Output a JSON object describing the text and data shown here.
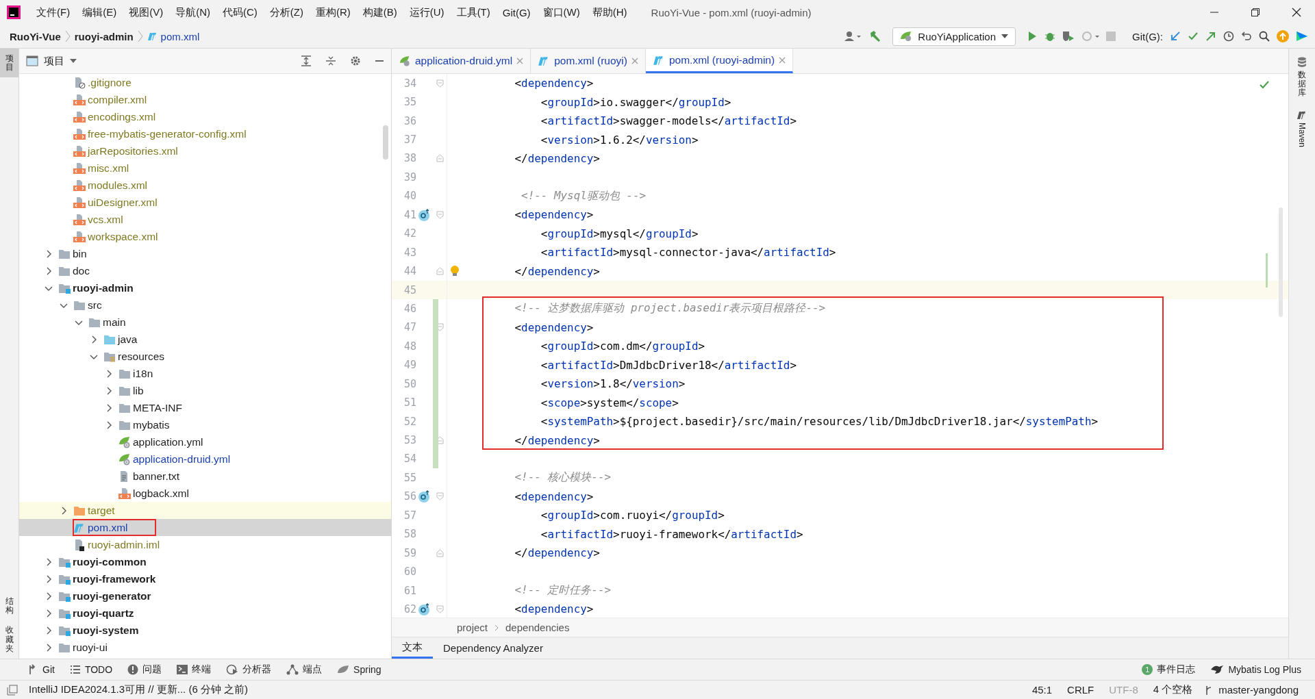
{
  "title_bar": {
    "menus": [
      "文件(F)",
      "编辑(E)",
      "视图(V)",
      "导航(N)",
      "代码(C)",
      "分析(Z)",
      "重构(R)",
      "构建(B)",
      "运行(U)",
      "工具(T)",
      "Git(G)",
      "窗口(W)",
      "帮助(H)"
    ],
    "title": "RuoYi-Vue - pom.xml (ruoyi-admin)"
  },
  "nav_bar": {
    "breadcrumbs": [
      {
        "label": "RuoYi-Vue",
        "kind": "project"
      },
      {
        "label": "ruoyi-admin",
        "kind": "module"
      },
      {
        "label": "pom.xml",
        "kind": "maven"
      }
    ],
    "run_config": "RuoYiApplication",
    "git_label": "Git(G):",
    "stop": {
      "disabled": true
    }
  },
  "left_strip": [
    {
      "label": "项目",
      "selected": true
    },
    {
      "label": "结构",
      "selected": false
    },
    {
      "label": "收藏夹",
      "selected": false
    }
  ],
  "project_panel": {
    "title": "项目"
  },
  "tree": {
    "items": [
      {
        "children": [
          {
            "label": ".gitignore",
            "kind": "ignore-file",
            "ignored": true,
            "selected": false
          },
          {
            "label": "compiler.xml",
            "kind": "xml-file",
            "ignored": true,
            "selected": false
          },
          {
            "label": "encodings.xml",
            "kind": "xml-file",
            "ignored": true,
            "selected": false
          },
          {
            "label": "free-mybatis-generator-config.xml",
            "kind": "xml-file",
            "ignored": true,
            "selected": false
          },
          {
            "label": "jarRepositories.xml",
            "kind": "xml-file",
            "ignored": true,
            "selected": false
          },
          {
            "label": "misc.xml",
            "kind": "xml-file",
            "ignored": true,
            "selected": false
          },
          {
            "label": "modules.xml",
            "kind": "xml-file",
            "ignored": true,
            "selected": false
          },
          {
            "label": "uiDesigner.xml",
            "kind": "xml-file",
            "ignored": true,
            "selected": false
          },
          {
            "label": "vcs.xml",
            "kind": "xml-file",
            "ignored": true,
            "selected": false
          },
          {
            "label": "workspace.xml",
            "kind": "xml-file",
            "ignored": true,
            "selected": false
          }
        ]
      },
      {
        "label": "bin",
        "kind": "folder",
        "expanded": false,
        "selected": false
      },
      {
        "label": "doc",
        "kind": "folder",
        "expanded": false,
        "selected": false
      },
      {
        "label": "ruoyi-admin",
        "kind": "module",
        "expanded": true,
        "selected": false,
        "children": [
          {
            "label": "src",
            "kind": "folder",
            "expanded": true,
            "selected": false,
            "children": [
              {
                "label": "main",
                "kind": "folder",
                "expanded": true,
                "selected": false,
                "children": [
                  {
                    "label": "java",
                    "kind": "source-folder",
                    "expanded": false,
                    "selected": false
                  },
                  {
                    "label": "resources",
                    "kind": "resources-folder",
                    "expanded": true,
                    "selected": false,
                    "children": [
                      {
                        "label": "i18n",
                        "kind": "folder",
                        "expanded": false,
                        "selected": false
                      },
                      {
                        "label": "lib",
                        "kind": "folder",
                        "expanded": false,
                        "selected": false
                      },
                      {
                        "label": "META-INF",
                        "kind": "folder",
                        "expanded": false,
                        "selected": false
                      },
                      {
                        "label": "mybatis",
                        "kind": "folder",
                        "expanded": false,
                        "selected": false
                      },
                      {
                        "label": "application.yml",
                        "kind": "yml-file",
                        "selected": false
                      },
                      {
                        "label": "application-druid.yml",
                        "kind": "yml-file",
                        "modified": true,
                        "selected": false
                      },
                      {
                        "label": "banner.txt",
                        "kind": "text-file",
                        "selected": false
                      },
                      {
                        "label": "logback.xml",
                        "kind": "xml-file",
                        "selected": false
                      }
                    ]
                  }
                ]
              }
            ]
          },
          {
            "label": "target",
            "kind": "excluded-folder",
            "ignored": true,
            "expanded": false,
            "selected": false
          },
          {
            "label": "pom.xml",
            "kind": "maven-file",
            "modified": true,
            "selected": true,
            "annotated": true
          },
          {
            "label": "ruoyi-admin.iml",
            "kind": "iml-file",
            "ignored": true,
            "selected": false
          }
        ]
      },
      {
        "label": "ruoyi-common",
        "kind": "module",
        "expanded": false,
        "selected": false
      },
      {
        "label": "ruoyi-framework",
        "kind": "module",
        "expanded": false,
        "selected": false
      },
      {
        "label": "ruoyi-generator",
        "kind": "module",
        "expanded": false,
        "selected": false
      },
      {
        "label": "ruoyi-quartz",
        "kind": "module",
        "expanded": false,
        "selected": false
      },
      {
        "label": "ruoyi-system",
        "kind": "module",
        "expanded": false,
        "selected": false
      },
      {
        "label": "ruoyi-ui",
        "kind": "folder",
        "expanded": false,
        "selected": false
      }
    ]
  },
  "editor_tabs": [
    {
      "label": "application-druid.yml",
      "kind": "yml",
      "selected": false
    },
    {
      "label": "pom.xml (ruoyi)",
      "kind": "maven",
      "selected": false
    },
    {
      "label": "pom.xml (ruoyi-admin)",
      "kind": "maven",
      "selected": true
    }
  ],
  "code": {
    "lines": [
      {
        "number": "34",
        "fold_start": true,
        "parts": [
          {
            "kind": "punct",
            "text": "        <"
          },
          {
            "kind": "tag",
            "text": "dependency"
          },
          {
            "kind": "punct",
            "text": ">"
          }
        ]
      },
      {
        "number": "35",
        "parts": [
          {
            "kind": "punct",
            "text": "            <"
          },
          {
            "kind": "tag",
            "text": "groupId"
          },
          {
            "kind": "punct",
            "text": ">"
          },
          {
            "kind": "text",
            "text": "io.swagger"
          },
          {
            "kind": "punct",
            "text": "</"
          },
          {
            "kind": "tag",
            "text": "groupId"
          },
          {
            "kind": "punct",
            "text": ">"
          }
        ]
      },
      {
        "number": "36",
        "parts": [
          {
            "kind": "punct",
            "text": "            <"
          },
          {
            "kind": "tag",
            "text": "artifactId"
          },
          {
            "kind": "punct",
            "text": ">"
          },
          {
            "kind": "text",
            "text": "swagger-models"
          },
          {
            "kind": "punct",
            "text": "</"
          },
          {
            "kind": "tag",
            "text": "artifactId"
          },
          {
            "kind": "punct",
            "text": ">"
          }
        ]
      },
      {
        "number": "37",
        "parts": [
          {
            "kind": "punct",
            "text": "            <"
          },
          {
            "kind": "tag",
            "text": "version"
          },
          {
            "kind": "punct",
            "text": ">"
          },
          {
            "kind": "text",
            "text": "1.6.2"
          },
          {
            "kind": "punct",
            "text": "</"
          },
          {
            "kind": "tag",
            "text": "version"
          },
          {
            "kind": "punct",
            "text": ">"
          }
        ]
      },
      {
        "number": "38",
        "fold_end": true,
        "parts": [
          {
            "kind": "punct",
            "text": "        </"
          },
          {
            "kind": "tag",
            "text": "dependency"
          },
          {
            "kind": "punct",
            "text": ">"
          }
        ]
      },
      {
        "number": "39"
      },
      {
        "number": "40",
        "parts": [
          {
            "kind": "comment",
            "text": "         <!-- Mysql驱动包 -->"
          }
        ]
      },
      {
        "number": "41",
        "fold_start": true,
        "implemented": true,
        "parts": [
          {
            "kind": "punct",
            "text": "        <"
          },
          {
            "kind": "tag",
            "text": "dependency"
          },
          {
            "kind": "punct",
            "text": ">"
          }
        ]
      },
      {
        "number": "42",
        "parts": [
          {
            "kind": "punct",
            "text": "            <"
          },
          {
            "kind": "tag",
            "text": "groupId"
          },
          {
            "kind": "punct",
            "text": ">"
          },
          {
            "kind": "text",
            "text": "mysql"
          },
          {
            "kind": "punct",
            "text": "</"
          },
          {
            "kind": "tag",
            "text": "groupId"
          },
          {
            "kind": "punct",
            "text": ">"
          }
        ]
      },
      {
        "number": "43",
        "parts": [
          {
            "kind": "punct",
            "text": "            <"
          },
          {
            "kind": "tag",
            "text": "artifactId"
          },
          {
            "kind": "punct",
            "text": ">"
          },
          {
            "kind": "text",
            "text": "mysql-connector-java"
          },
          {
            "kind": "punct",
            "text": "</"
          },
          {
            "kind": "tag",
            "text": "artifactId"
          },
          {
            "kind": "punct",
            "text": ">"
          }
        ]
      },
      {
        "number": "44",
        "fold_end": true,
        "bulb": true,
        "parts": [
          {
            "kind": "punct",
            "text": "        </"
          },
          {
            "kind": "tag",
            "text": "dependency"
          },
          {
            "kind": "punct",
            "text": ">"
          }
        ]
      },
      {
        "number": "45",
        "current": true
      },
      {
        "number": "46",
        "changed": true,
        "boxed": true,
        "parts": [
          {
            "kind": "comment",
            "text": "        <!-- 达梦数据库驱动 project.basedir表示项目根路径-->"
          }
        ]
      },
      {
        "number": "47",
        "changed": true,
        "boxed": true,
        "fold_start": true,
        "parts": [
          {
            "kind": "punct",
            "text": "        <"
          },
          {
            "kind": "tag",
            "text": "dependency"
          },
          {
            "kind": "punct",
            "text": ">"
          }
        ]
      },
      {
        "number": "48",
        "changed": true,
        "boxed": true,
        "parts": [
          {
            "kind": "punct",
            "text": "            <"
          },
          {
            "kind": "tag",
            "text": "groupId"
          },
          {
            "kind": "punct",
            "text": ">"
          },
          {
            "kind": "text",
            "text": "com.dm"
          },
          {
            "kind": "punct",
            "text": "</"
          },
          {
            "kind": "tag",
            "text": "groupId"
          },
          {
            "kind": "punct",
            "text": ">"
          }
        ]
      },
      {
        "number": "49",
        "changed": true,
        "boxed": true,
        "parts": [
          {
            "kind": "punct",
            "text": "            <"
          },
          {
            "kind": "tag",
            "text": "artifactId"
          },
          {
            "kind": "punct",
            "text": ">"
          },
          {
            "kind": "text",
            "text": "DmJdbcDriver18"
          },
          {
            "kind": "punct",
            "text": "</"
          },
          {
            "kind": "tag",
            "text": "artifactId"
          },
          {
            "kind": "punct",
            "text": ">"
          }
        ]
      },
      {
        "number": "50",
        "changed": true,
        "boxed": true,
        "parts": [
          {
            "kind": "punct",
            "text": "            <"
          },
          {
            "kind": "tag",
            "text": "version"
          },
          {
            "kind": "punct",
            "text": ">"
          },
          {
            "kind": "text",
            "text": "1.8"
          },
          {
            "kind": "punct",
            "text": "</"
          },
          {
            "kind": "tag",
            "text": "version"
          },
          {
            "kind": "punct",
            "text": ">"
          }
        ]
      },
      {
        "number": "51",
        "changed": true,
        "boxed": true,
        "parts": [
          {
            "kind": "punct",
            "text": "            <"
          },
          {
            "kind": "tag",
            "text": "scope"
          },
          {
            "kind": "punct",
            "text": ">"
          },
          {
            "kind": "text",
            "text": "system"
          },
          {
            "kind": "punct",
            "text": "</"
          },
          {
            "kind": "tag",
            "text": "scope"
          },
          {
            "kind": "punct",
            "text": ">"
          }
        ]
      },
      {
        "number": "52",
        "changed": true,
        "boxed": true,
        "parts": [
          {
            "kind": "punct",
            "text": "            <"
          },
          {
            "kind": "tag",
            "text": "systemPath"
          },
          {
            "kind": "punct",
            "text": ">"
          },
          {
            "kind": "text",
            "text": "${project.basedir}/src/main/resources/lib/DmJdbcDriver18.jar"
          },
          {
            "kind": "punct",
            "text": "</"
          },
          {
            "kind": "tag",
            "text": "systemPath"
          },
          {
            "kind": "punct",
            "text": ">"
          }
        ]
      },
      {
        "number": "53",
        "changed": true,
        "boxed": true,
        "fold_end": true,
        "parts": [
          {
            "kind": "punct",
            "text": "        </"
          },
          {
            "kind": "tag",
            "text": "dependency"
          },
          {
            "kind": "punct",
            "text": ">"
          }
        ]
      },
      {
        "number": "54",
        "changed": true
      },
      {
        "number": "55",
        "parts": [
          {
            "kind": "comment",
            "text": "        <!-- 核心模块-->"
          }
        ]
      },
      {
        "number": "56",
        "fold_start": true,
        "implemented": true,
        "parts": [
          {
            "kind": "punct",
            "text": "        <"
          },
          {
            "kind": "tag",
            "text": "dependency"
          },
          {
            "kind": "punct",
            "text": ">"
          }
        ]
      },
      {
        "number": "57",
        "parts": [
          {
            "kind": "punct",
            "text": "            <"
          },
          {
            "kind": "tag",
            "text": "groupId"
          },
          {
            "kind": "punct",
            "text": ">"
          },
          {
            "kind": "text",
            "text": "com.ruoyi"
          },
          {
            "kind": "punct",
            "text": "</"
          },
          {
            "kind": "tag",
            "text": "groupId"
          },
          {
            "kind": "punct",
            "text": ">"
          }
        ]
      },
      {
        "number": "58",
        "parts": [
          {
            "kind": "punct",
            "text": "            <"
          },
          {
            "kind": "tag",
            "text": "artifactId"
          },
          {
            "kind": "punct",
            "text": ">"
          },
          {
            "kind": "text",
            "text": "ruoyi-framework"
          },
          {
            "kind": "punct",
            "text": "</"
          },
          {
            "kind": "tag",
            "text": "artifactId"
          },
          {
            "kind": "punct",
            "text": ">"
          }
        ]
      },
      {
        "number": "59",
        "fold_end": true,
        "parts": [
          {
            "kind": "punct",
            "text": "        </"
          },
          {
            "kind": "tag",
            "text": "dependency"
          },
          {
            "kind": "punct",
            "text": ">"
          }
        ]
      },
      {
        "number": "60"
      },
      {
        "number": "61",
        "parts": [
          {
            "kind": "comment",
            "text": "        <!-- 定时任务-->"
          }
        ]
      },
      {
        "number": "62",
        "fold_start": true,
        "implemented": true,
        "parts": [
          {
            "kind": "punct",
            "text": "        <"
          },
          {
            "kind": "tag",
            "text": "dependency"
          },
          {
            "kind": "punct",
            "text": ">"
          }
        ]
      }
    ]
  },
  "editor_breadcrumbs": [
    "project",
    "dependencies"
  ],
  "editor_bottom_tabs": [
    {
      "label": "文本",
      "selected": true
    },
    {
      "label": "Dependency Analyzer",
      "selected": false
    }
  ],
  "right_strip": [
    {
      "label": "数据库",
      "kind": "cjk"
    },
    {
      "label": "Maven",
      "kind": "latin"
    }
  ],
  "tool_windows": [
    {
      "label": "Git",
      "kind": "git"
    },
    {
      "label": "TODO",
      "kind": "todo"
    },
    {
      "label": "问题",
      "kind": "problems"
    },
    {
      "label": "终端",
      "kind": "terminal"
    },
    {
      "label": "分析器",
      "kind": "profiler"
    },
    {
      "label": "端点",
      "kind": "endpoints"
    },
    {
      "label": "Spring",
      "kind": "spring"
    }
  ],
  "tool_windows_right": [
    {
      "label": "事件日志",
      "kind": "events",
      "count": "1"
    },
    {
      "label": "Mybatis Log Plus",
      "kind": "bird"
    }
  ],
  "status_bar": {
    "message": "IntelliJ IDEA2024.1.3可用 // 更新... (6 分钟 之前)",
    "items": [
      {
        "label": "45:1",
        "disabled": false
      },
      {
        "label": "CRLF",
        "disabled": false
      },
      {
        "label": "UTF-8",
        "disabled": true
      },
      {
        "label": "4 个空格",
        "disabled": false
      }
    ],
    "branch": "master-yangdong"
  }
}
